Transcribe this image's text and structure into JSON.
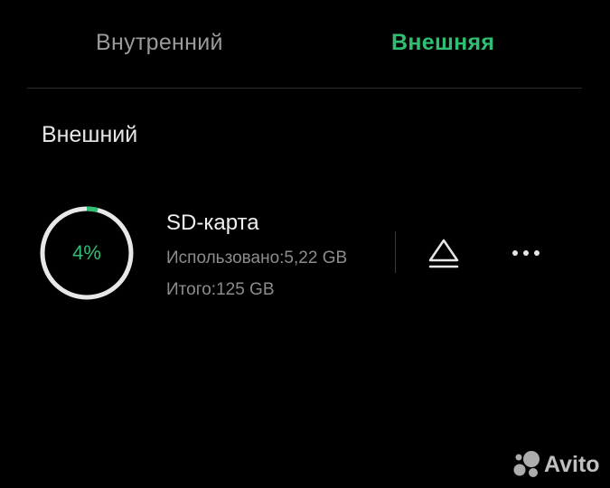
{
  "tabs": [
    {
      "label": "Внутренний",
      "active": false
    },
    {
      "label": "Внешняя",
      "active": true
    }
  ],
  "colors": {
    "accent": "#2fbf73",
    "background": "#000000",
    "ring_track": "#e8e8e8",
    "secondary_text": "#8c8c8c"
  },
  "section": {
    "title": "Внешний"
  },
  "storage": {
    "name": "SD-карта",
    "percent_label": "4%",
    "used_fraction": 0.04,
    "used": "Использовано:5,22 GB",
    "total": "Итого:125 GB"
  },
  "actions": {
    "eject_icon": "eject-icon",
    "more_icon": "more-horizontal-icon"
  },
  "watermark": {
    "text": "Avito"
  }
}
